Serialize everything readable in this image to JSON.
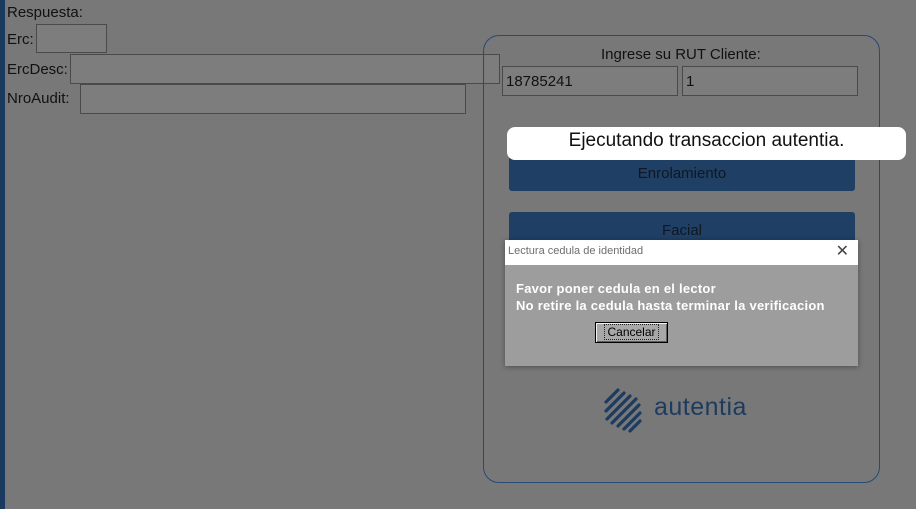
{
  "form": {
    "respuesta_label": "Respuesta:",
    "erc_label": "Erc:",
    "erc_value": "",
    "ercdesc_label": "ErcDesc:",
    "ercdesc_value": "",
    "nroaudit_label": "NroAudit:",
    "nroaudit_value": ""
  },
  "panel": {
    "rut_label": "Ingrese su RUT Cliente:",
    "rut_value": "18785241",
    "dv_value": "1",
    "toast": "Ejecutando transaccion autentia.",
    "enrolamiento_label": "Enrolamiento",
    "facial_label": "Facial",
    "logo_text": "autentia",
    "logo_icon": "autentia-stripes-icon"
  },
  "dialog": {
    "title": "Lectura cedula de identidad",
    "close_icon": "close-icon",
    "message_line1": "Favor poner cedula en el lector",
    "message_line2": "No retire la cedula hasta terminar la verificacion",
    "cancel_label": "Cancelar"
  },
  "colors": {
    "overlay_gray": "#787878",
    "brand_blue": "#1d3a5f",
    "dialog_gray": "#9d9d9d"
  }
}
